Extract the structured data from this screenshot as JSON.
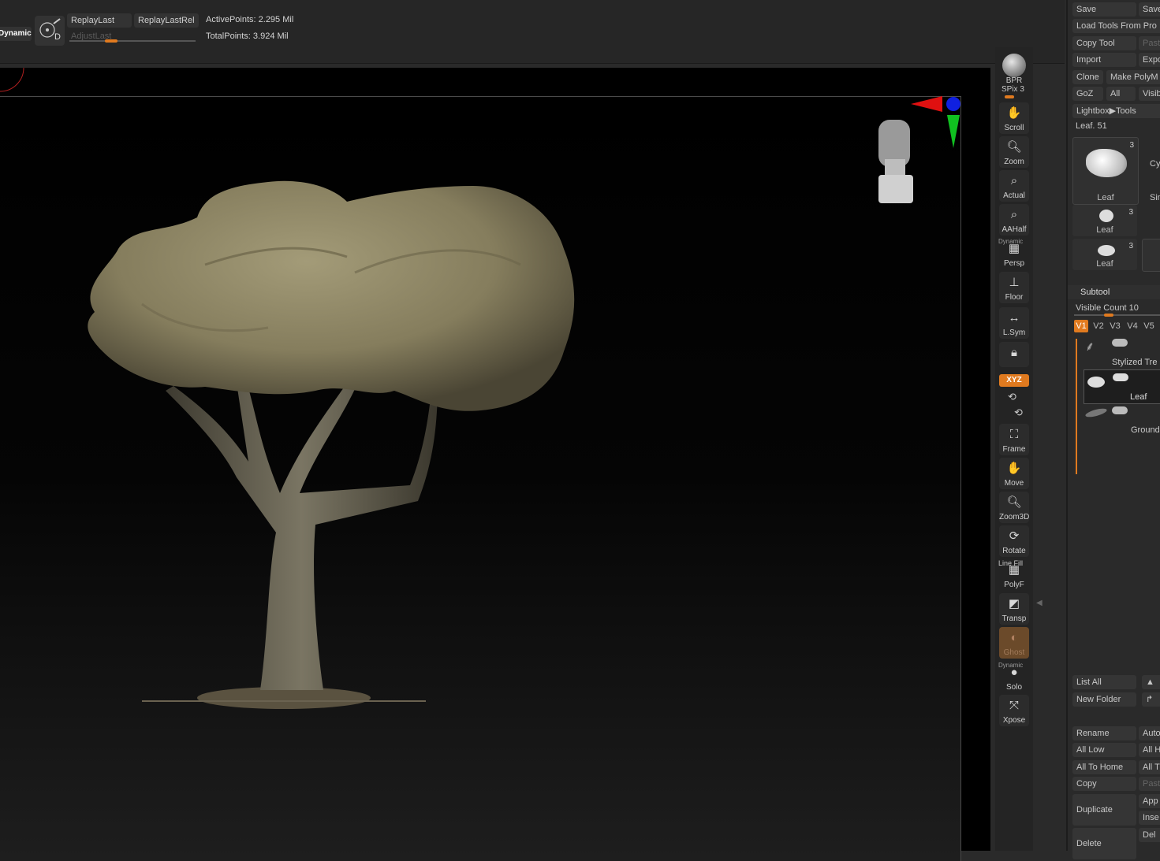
{
  "topbar": {
    "dynamic_label": "Dynamic",
    "replay_last": "ReplayLast",
    "replay_last_rel": "ReplayLastRel",
    "adjust_last": "AdjustLast",
    "active_points": "ActivePoints: 2.295 Mil",
    "total_points": "TotalPoints: 3.924 Mil",
    "adjust_last_level": 0.33
  },
  "shelf": {
    "bpr": "BPR",
    "spix": "SPix 3",
    "scroll": "Scroll",
    "zoom": "Zoom",
    "actual": "Actual",
    "aahalf": "AAHalf",
    "dynamic_top": "Dynamic",
    "persp": "Persp",
    "floor": "Floor",
    "lsym": "L.Sym",
    "xyz": "XYZ",
    "frame": "Frame",
    "move": "Move",
    "zoom3d": "Zoom3D",
    "rotate": "Rotate",
    "line_fill": "Line Fill",
    "polyf": "PolyF",
    "transp": "Transp",
    "ghost": "Ghost",
    "dynamic_bottom": "Dynamic",
    "solo": "Solo",
    "xpose": "Xpose"
  },
  "palette": {
    "save": "Save",
    "save_as": "Save",
    "load_tools": "Load Tools From Pro",
    "copy_tool": "Copy Tool",
    "paste": "Past",
    "import": "Import",
    "export": "Expo",
    "clone": "Clone",
    "make_polymesh": "Make PolyM",
    "goz": "GoZ",
    "all": "All",
    "visible": "Visib",
    "lightbox_tools": "Lightbox▶Tools",
    "leaf_value": "Leaf. 51",
    "thumbs": [
      {
        "name": "Leaf",
        "count": "3"
      },
      {
        "name": "Leaf",
        "count": "3"
      },
      {
        "name": "Leaf",
        "count": "3"
      }
    ],
    "side_labels": [
      "Cy",
      "Sim"
    ],
    "subtool_title": "Subtool",
    "visible_count": "Visible Count 10",
    "visible_count_level": 0.4,
    "vtabs": [
      "V1",
      "V2",
      "V3",
      "V4",
      "V5"
    ],
    "subtools": [
      "Stylized Tre",
      "Leaf",
      "Ground"
    ],
    "list_all": "List All",
    "new_folder": "New Folder",
    "rename": "Rename",
    "auto": "Auto",
    "all_low": "All Low",
    "all_h": "All H",
    "all_to_home": "All To Home",
    "all_t": "All T",
    "copy": "Copy",
    "paste2": "Past",
    "duplicate": "Duplicate",
    "append": "App",
    "insert": "Inse",
    "delete": "Delete",
    "del": "Del"
  },
  "colors": {
    "accent": "#e07a1f",
    "background": "#2a2a2a",
    "viewport": "#000000",
    "tree_canopy": "#8d8565",
    "tree_trunk": "#6e6a58"
  }
}
